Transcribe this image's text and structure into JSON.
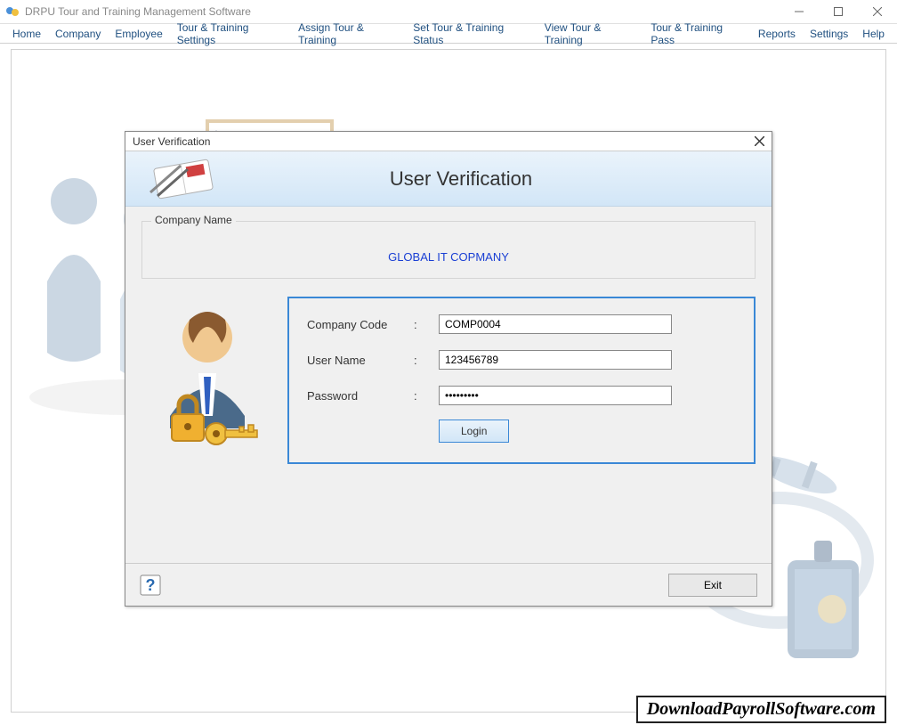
{
  "window": {
    "title": "DRPU Tour and Training Management Software"
  },
  "menu": [
    "Home",
    "Company",
    "Employee",
    "Tour & Training Settings",
    "Assign Tour & Training",
    "Set Tour & Training Status",
    "View Tour & Training",
    "Tour & Training Pass",
    "Reports",
    "Settings",
    "Help"
  ],
  "dialog": {
    "title": "User Verification",
    "heading": "User Verification",
    "company_group_label": "Company Name",
    "company_name": "GLOBAL IT COPMANY",
    "labels": {
      "company_code": "Company Code",
      "user_name": "User Name",
      "password": "Password"
    },
    "values": {
      "company_code": "COMP0004",
      "user_name": "123456789",
      "password": "•••••••••"
    },
    "login_button": "Login",
    "exit_button": "Exit"
  },
  "watermark": "DownloadPayrollSoftware.com"
}
